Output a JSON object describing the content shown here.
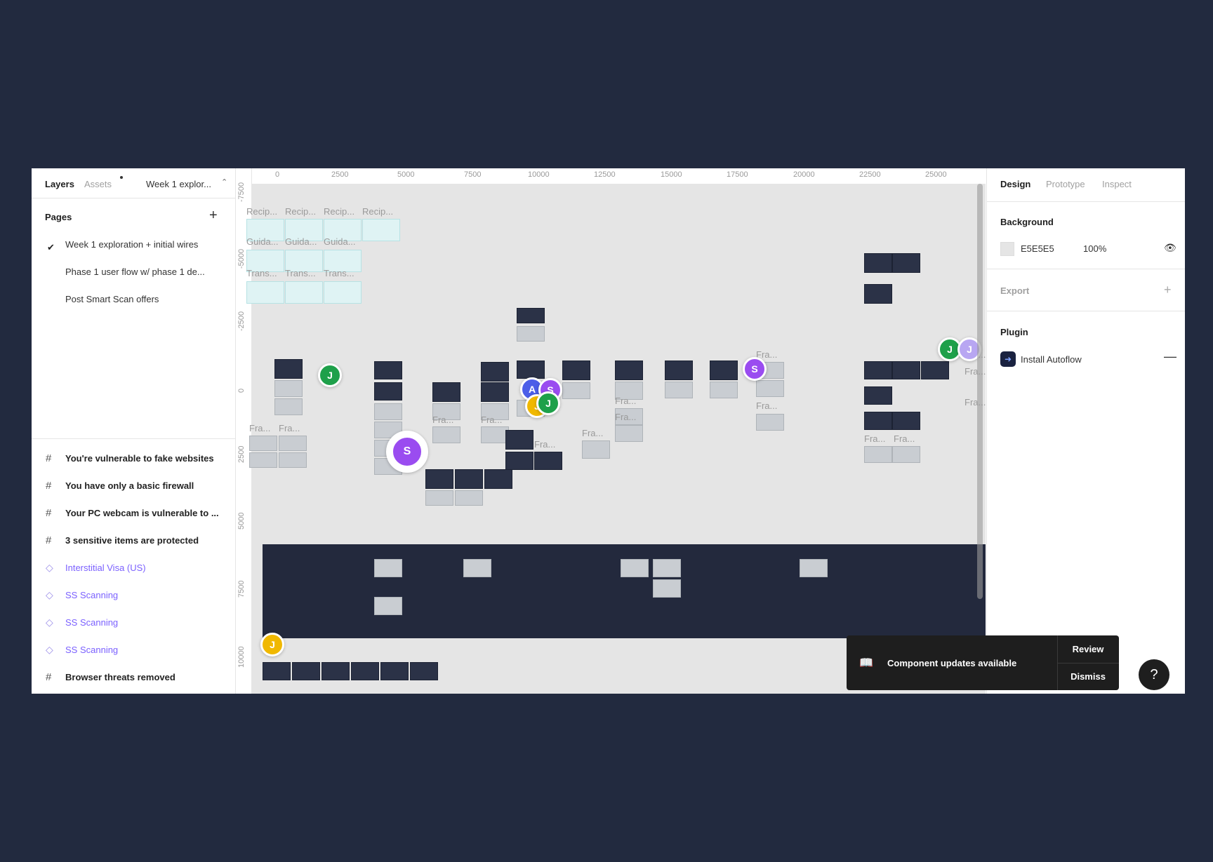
{
  "left_panel": {
    "tabs": {
      "layers": "Layers",
      "assets": "Assets",
      "page_selector": "Week 1 explor..."
    },
    "pages_header": "Pages",
    "pages": [
      {
        "label": "Week 1 exploration + initial wires",
        "selected": true
      },
      {
        "label": "Phase 1 user flow w/ phase 1 de..."
      },
      {
        "label": "Post Smart Scan offers"
      }
    ],
    "layers": [
      {
        "label": "You're vulnerable to fake websites",
        "type": "frame"
      },
      {
        "label": "You have only a basic firewall",
        "type": "frame"
      },
      {
        "label": "Your PC webcam is vulnerable to ...",
        "type": "frame"
      },
      {
        "label": "3 sensitive items are protected",
        "type": "frame"
      },
      {
        "label": "Interstitial Visa (US)",
        "type": "component"
      },
      {
        "label": "SS Scanning",
        "type": "component"
      },
      {
        "label": "SS Scanning",
        "type": "component"
      },
      {
        "label": "SS Scanning",
        "type": "component"
      },
      {
        "label": "Browser threats removed",
        "type": "frame"
      }
    ]
  },
  "canvas": {
    "ruler_top": [
      "0",
      "2500",
      "5000",
      "7500",
      "10000",
      "12500",
      "15000",
      "17500",
      "20000",
      "22500",
      "25000"
    ],
    "ruler_left": [
      "-7500",
      "-5000",
      "-2500",
      "0",
      "2500",
      "5000",
      "7500",
      "10000"
    ],
    "frame_labels": {
      "recip": [
        "Recip...",
        "Recip...",
        "Recip...",
        "Recip..."
      ],
      "guida": [
        "Guida...",
        "Guida...",
        "Guida..."
      ],
      "trans": [
        "Trans...",
        "Trans...",
        "Trans..."
      ],
      "fra": "Fra...",
      "fra_short": "Fra..."
    },
    "avatars": {
      "j": "J",
      "s": "S",
      "a": "A"
    }
  },
  "right_panel": {
    "tabs": {
      "design": "Design",
      "prototype": "Prototype",
      "inspect": "Inspect"
    },
    "background_label": "Background",
    "background_hex": "E5E5E5",
    "background_opacity": "100%",
    "export_label": "Export",
    "plugin_label": "Plugin",
    "plugin_name": "Install Autoflow"
  },
  "toast": {
    "message": "Component updates available",
    "review": "Review",
    "dismiss": "Dismiss"
  },
  "help": "?",
  "colors": {
    "backdrop": "#222a3f",
    "canvas": "#e5e5e5",
    "accent_component": "#7b61ff",
    "avatar_green": "#1ea04a",
    "avatar_purple": "#9a4cf0",
    "avatar_yellow": "#f0b800"
  }
}
